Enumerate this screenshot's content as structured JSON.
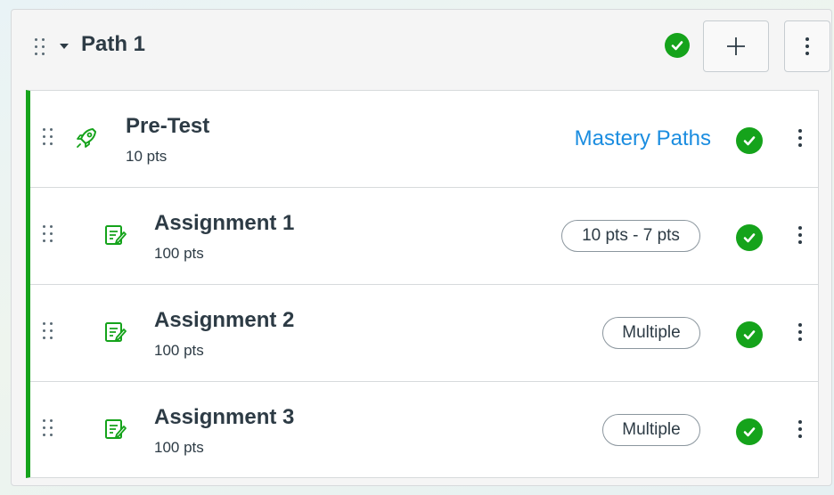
{
  "path": {
    "title": "Path 1",
    "status_icon": "check-circle-icon",
    "add_icon": "plus-icon",
    "more_icon": "kebab-vertical-icon"
  },
  "items": [
    {
      "title": "Pre-Test",
      "points": "10 pts",
      "icon": "rocket-icon",
      "action_label": "Mastery Paths",
      "action_type": "link"
    },
    {
      "title": "Assignment 1",
      "points": "100 pts",
      "icon": "assignment-icon",
      "action_label": "10 pts - 7 pts",
      "action_type": "pill"
    },
    {
      "title": "Assignment 2",
      "points": "100 pts",
      "icon": "assignment-icon",
      "action_label": "Multiple",
      "action_type": "pill"
    },
    {
      "title": "Assignment 3",
      "points": "100 pts",
      "icon": "assignment-icon",
      "action_label": "Multiple",
      "action_type": "pill"
    }
  ],
  "colors": {
    "accent_green": "#15a31b",
    "link_blue": "#1b8de0",
    "text": "#2d3b45"
  }
}
